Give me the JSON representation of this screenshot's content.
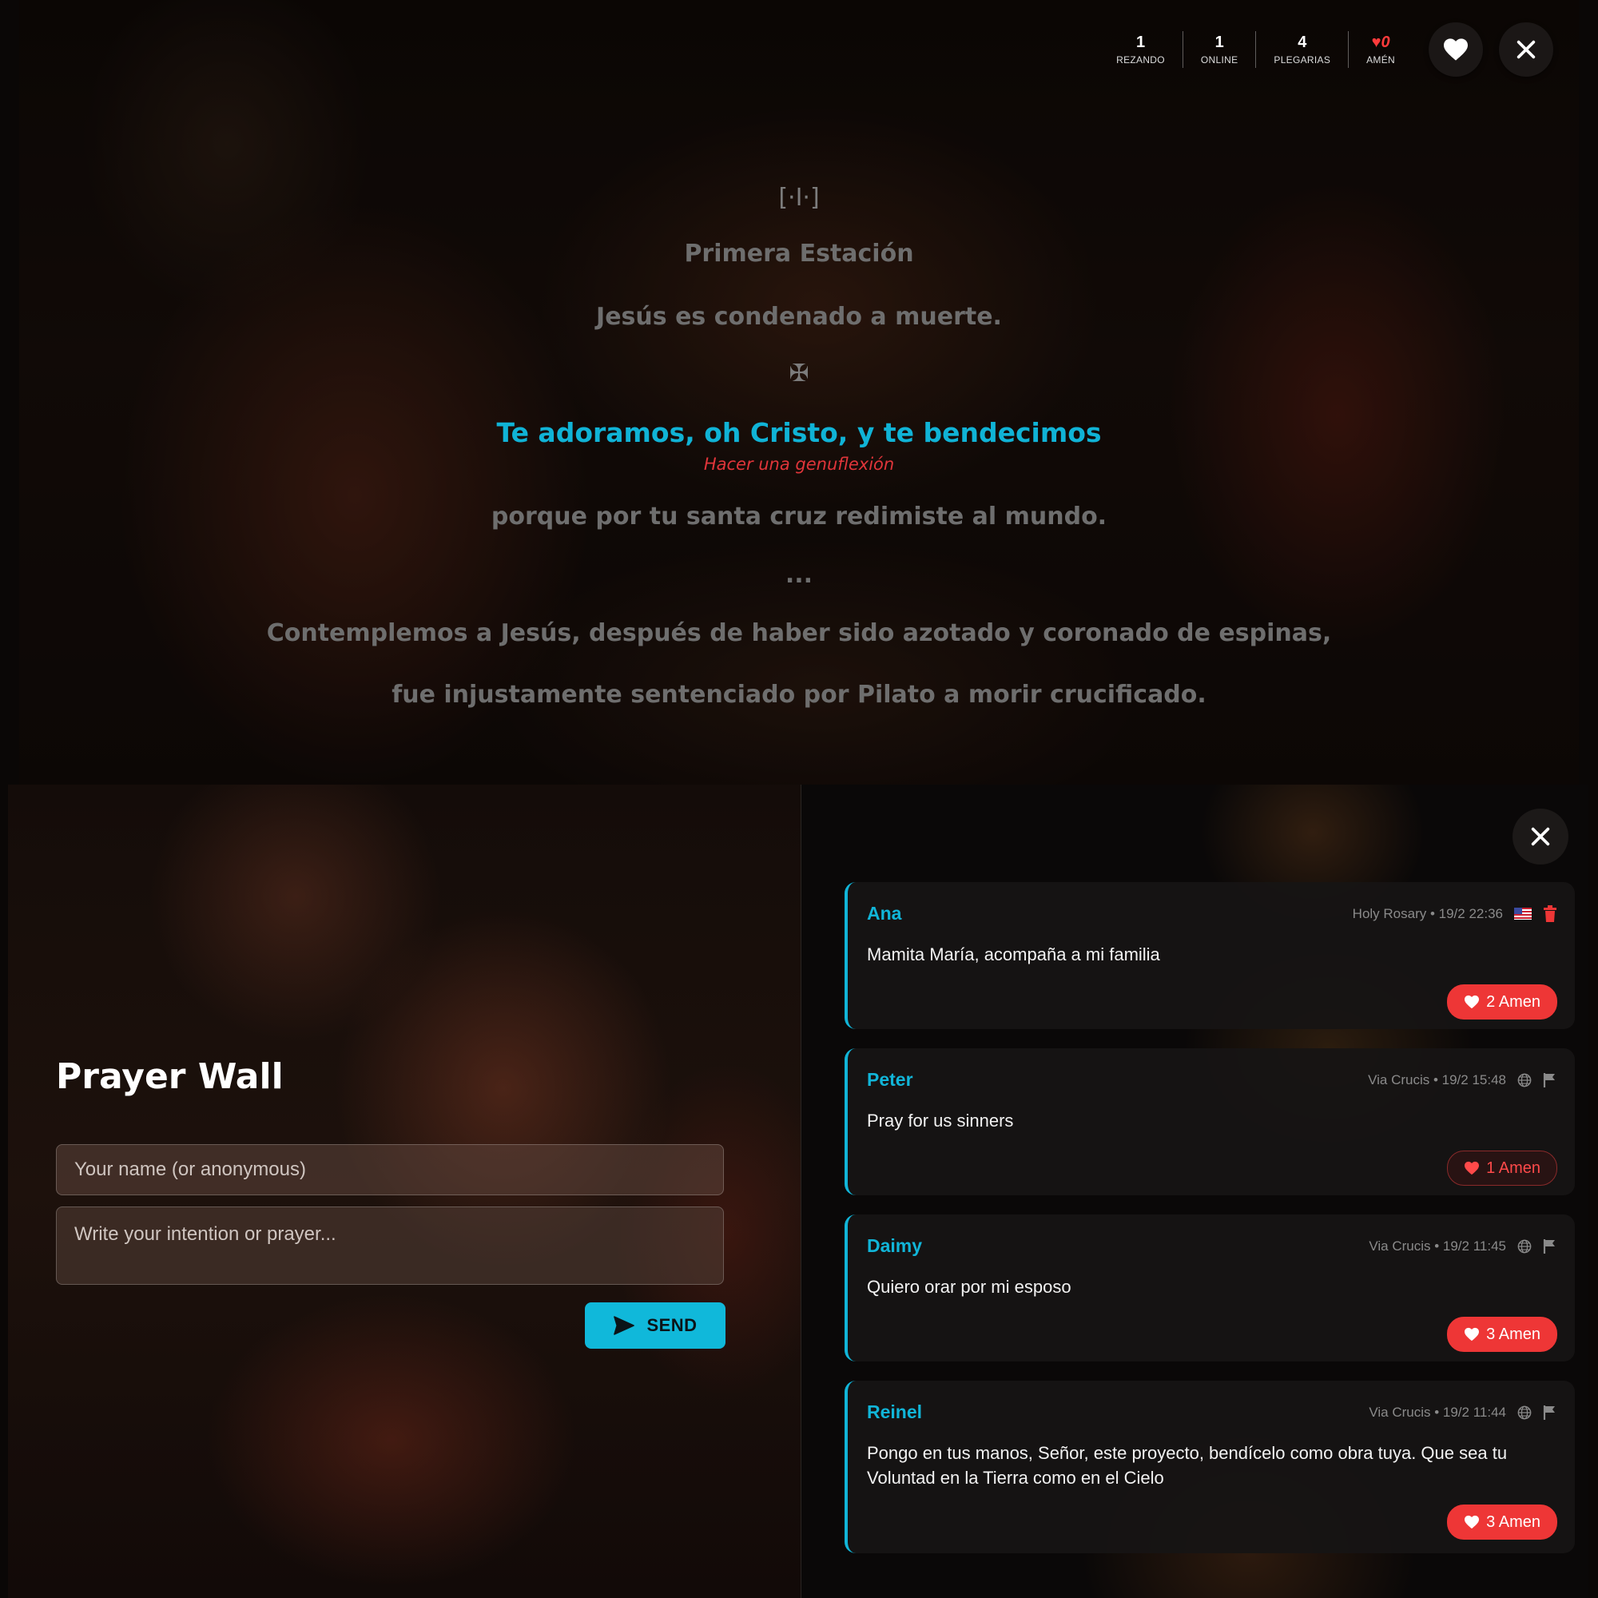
{
  "stats": [
    {
      "value": "1",
      "label": "REZANDO"
    },
    {
      "value": "1",
      "label": "ONLINE"
    },
    {
      "value": "4",
      "label": "PLEGARIAS"
    },
    {
      "value": "0",
      "label": "AMÉN"
    }
  ],
  "prayer": {
    "station_symbol": "[·I·]",
    "station_title": "Primera Estación",
    "station_subtitle": "Jesús es condenado a muerte.",
    "cross_symbol": "✠",
    "highlight": "Te adoramos, oh Cristo, y te bendecimos",
    "rubric": "Hacer una genuflexión",
    "response": "porque por tu santa cruz redimiste al mundo.",
    "ellipsis": "...",
    "meditation_1": "Contemplemos a Jesús, después de haber sido azotado y coronado de espinas,",
    "meditation_2": "fue injustamente sentenciado por Pilato a morir crucificado."
  },
  "wall": {
    "title": "Prayer Wall",
    "name_placeholder": "Your name (or anonymous)",
    "prayer_placeholder": "Write your intention or prayer...",
    "send_label": "SEND"
  },
  "posts": [
    {
      "name": "Ana",
      "meta": "Holy Rosary • 19/2 22:36",
      "text": "Mamita María, acompaña a mi familia",
      "amen": "2 Amen"
    },
    {
      "name": "Peter",
      "meta": "Via Crucis • 19/2 15:48",
      "text": "Pray for us sinners",
      "amen": "1 Amen"
    },
    {
      "name": "Daimy",
      "meta": "Via Crucis • 19/2 11:45",
      "text": "Quiero orar por mi esposo",
      "amen": "3 Amen"
    },
    {
      "name": "Reinel",
      "meta": "Via Crucis • 19/2 11:44",
      "text": "Pongo en tus manos, Señor, este proyecto, bendícelo como obra tuya. Que sea tu Voluntad en la Tierra como en el Cielo",
      "amen": "3 Amen"
    }
  ],
  "colors": {
    "accent": "#11b5d8",
    "amen_red": "#ee3636",
    "rubric_red": "#e0353a"
  },
  "icons": [
    "heart-icon",
    "close-icon",
    "send-icon",
    "trash-icon",
    "globe-icon",
    "flag-icon",
    "us-flag-icon"
  ]
}
